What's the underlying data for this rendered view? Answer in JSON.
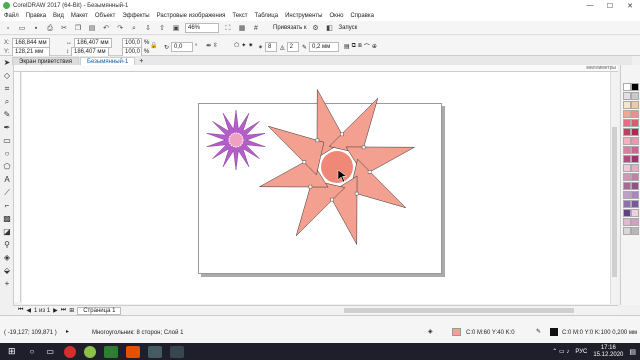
{
  "window": {
    "title": "CorelDRAW 2017 (64-Bit) - Безымянный-1",
    "min": "—",
    "max": "☐",
    "close": "✕"
  },
  "menu": [
    "Файл",
    "Правка",
    "Вид",
    "Макет",
    "Объект",
    "Эффекты",
    "Растровые изображения",
    "Текст",
    "Таблица",
    "Инструменты",
    "Окно",
    "Справка"
  ],
  "toolbar1": {
    "zoom": "46%",
    "snap": "Привязать к",
    "launch": "Запуск"
  },
  "toolbar2": {
    "x_label": "X:",
    "x": "168,844 мм",
    "y_label": "Y:",
    "y": "128,21 мм",
    "w": "186,407 мм",
    "h": "186,407 мм",
    "sx": "100,0",
    "sy": "100,0",
    "pct": "%",
    "angle": "0,0",
    "deg": "°",
    "points": "8",
    "sharp": "2",
    "outline": "0,2 мм"
  },
  "tabs": [
    "Экран приветствия",
    "Безымянный-1"
  ],
  "ruler_unit": "миллиметры",
  "pagebar": {
    "page_of": "1 из 1",
    "page_tab": "Страница 1"
  },
  "status": {
    "coords": "( -19,127; 109,871 )",
    "object_info": "Многоугольник: 8 сторон; Слой 1",
    "fill": "C:0 M:60 Y:40 K:0",
    "outline": "C:0 M:0 Y:0 K:100  0,200 мм"
  },
  "clock": {
    "time": "17:16",
    "date": "15.12.2020"
  },
  "tray_lang": "РУС",
  "colors": {
    "star_fill": "#f4a090",
    "small_star_fill": "#b45fc8",
    "accent": "#0b5fa5"
  }
}
